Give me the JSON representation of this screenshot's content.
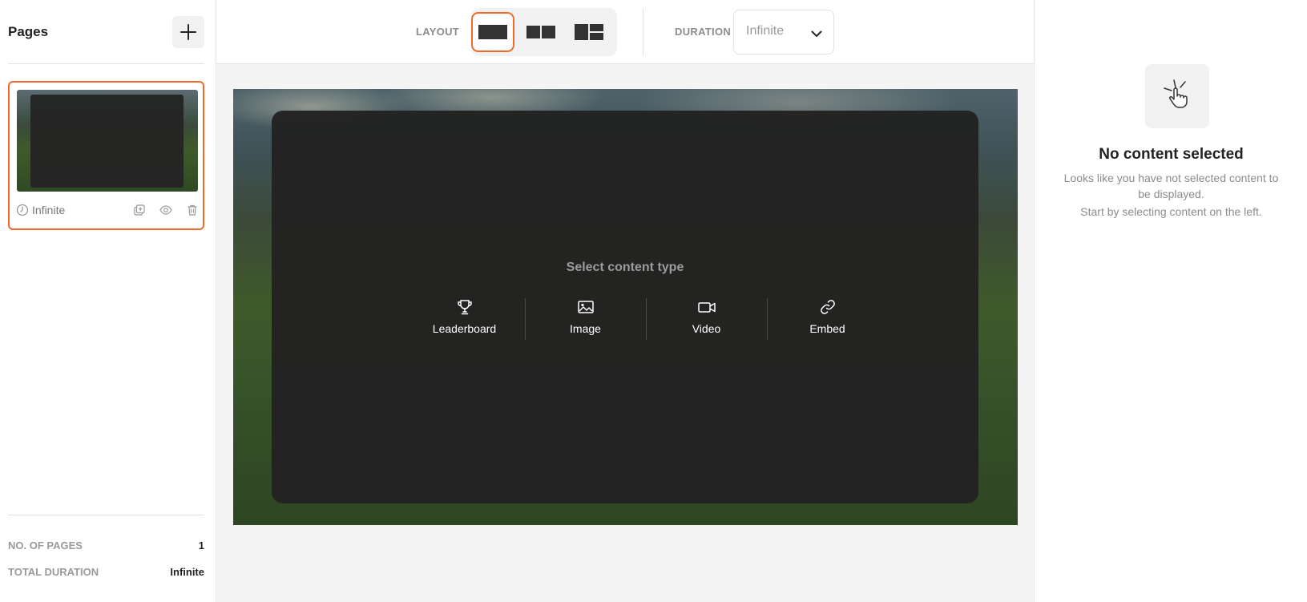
{
  "sidebar": {
    "title": "Pages",
    "add_icon": "plus-icon",
    "page_card": {
      "duration": "Infinite",
      "duration_icon": "timer-icon",
      "actions": [
        "duplicate-icon",
        "eye-icon",
        "trash-icon"
      ]
    },
    "stats": {
      "pages_label": "NO. OF PAGES",
      "pages_value": "1",
      "duration_label": "TOTAL DURATION",
      "duration_value": "Infinite"
    }
  },
  "toolbar": {
    "layout_label": "LAYOUT",
    "layout_options": [
      "single",
      "two-column",
      "split"
    ],
    "layout_selected": "single",
    "duration_label": "DURATION",
    "duration_value": "Infinite"
  },
  "canvas": {
    "prompt": "Select content type",
    "content_types": [
      {
        "label": "Leaderboard",
        "icon": "trophy-icon"
      },
      {
        "label": "Image",
        "icon": "image-icon"
      },
      {
        "label": "Video",
        "icon": "video-icon"
      },
      {
        "label": "Embed",
        "icon": "link-icon"
      }
    ]
  },
  "right_panel": {
    "icon": "pointer-click-icon",
    "title": "No content selected",
    "description": "Looks like you have not selected content to be displayed.",
    "hint": "Start by selecting content on the left."
  },
  "colors": {
    "accent": "#f2692a",
    "overlay": "#222222"
  }
}
